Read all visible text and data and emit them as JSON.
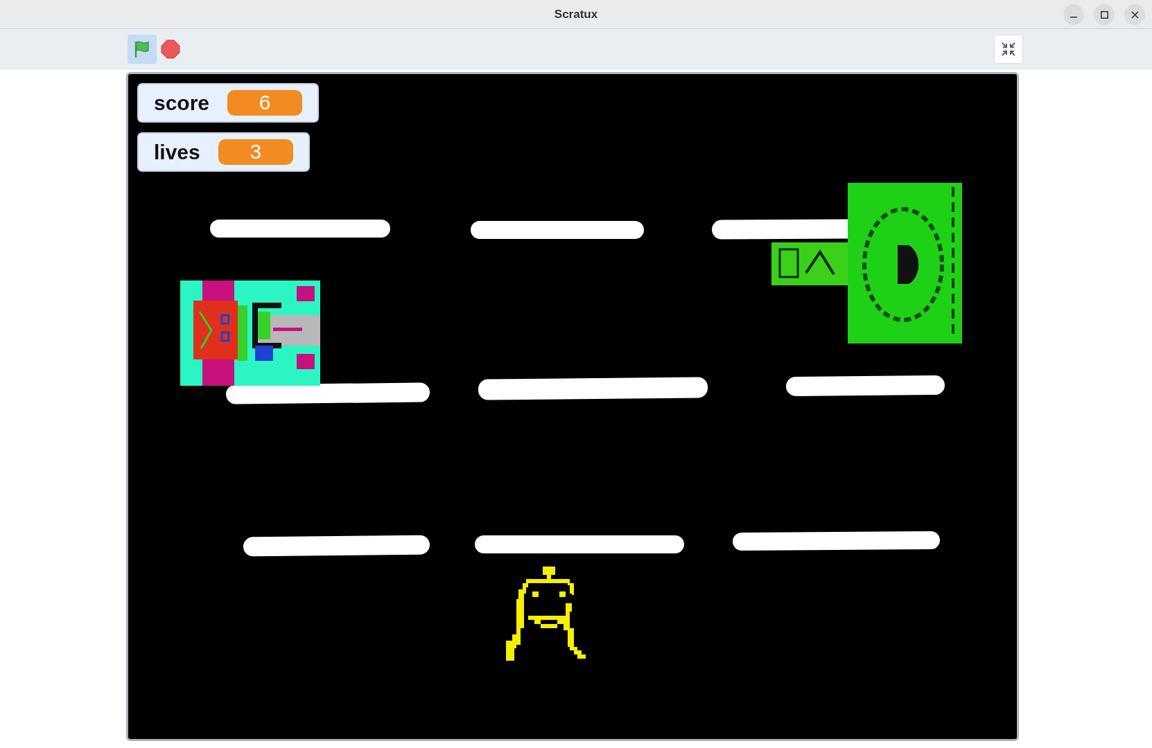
{
  "window": {
    "title": "Scratux"
  },
  "monitors": [
    {
      "label": "score",
      "value": "6"
    },
    {
      "label": "lives",
      "value": "3"
    }
  ]
}
